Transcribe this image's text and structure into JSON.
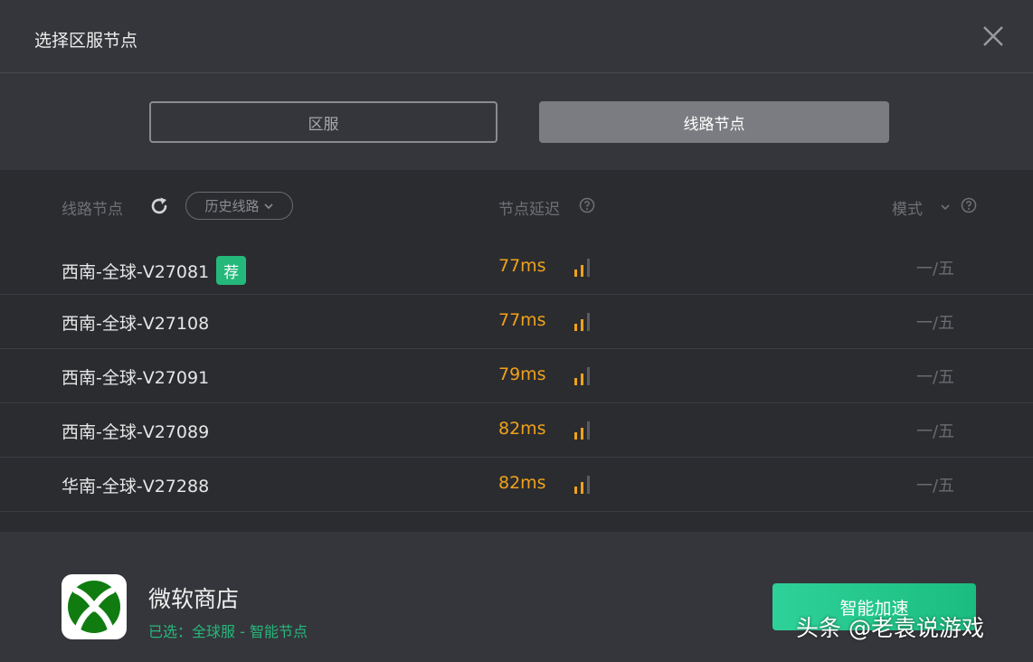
{
  "dialog": {
    "title": "选择区服节点"
  },
  "tabs": [
    {
      "label": "区服",
      "active": false
    },
    {
      "label": "线路节点",
      "active": true
    }
  ],
  "list_header": {
    "node_label": "线路节点",
    "history_label": "历史线路",
    "latency_label": "节点延迟",
    "mode_label": "模式"
  },
  "nodes": [
    {
      "name": "西南-全球-V27081",
      "recommended": true,
      "badge": "荐",
      "latency": "77ms",
      "mode": "一/五"
    },
    {
      "name": "西南-全球-V27108",
      "recommended": false,
      "latency": "77ms",
      "mode": "一/五"
    },
    {
      "name": "西南-全球-V27091",
      "recommended": false,
      "latency": "79ms",
      "mode": "一/五"
    },
    {
      "name": "西南-全球-V27089",
      "recommended": false,
      "latency": "82ms",
      "mode": "一/五"
    },
    {
      "name": "华南-全球-V27288",
      "recommended": false,
      "latency": "82ms",
      "mode": "一/五"
    }
  ],
  "app": {
    "name": "微软商店",
    "selected": "已选：全球服 - 智能节点",
    "boost_label": "智能加速"
  },
  "watermark": "头条 @老袁说游戏",
  "colors": {
    "accent_green": "#25b87b",
    "latency_orange": "#f0a21a",
    "xbox_green": "#107c10"
  },
  "icons": {
    "close": "close-icon",
    "refresh": "refresh-icon",
    "help": "help-icon",
    "signal": "signal-icon",
    "chevron": "chevron-down-icon",
    "logo": "xbox-logo-icon"
  }
}
